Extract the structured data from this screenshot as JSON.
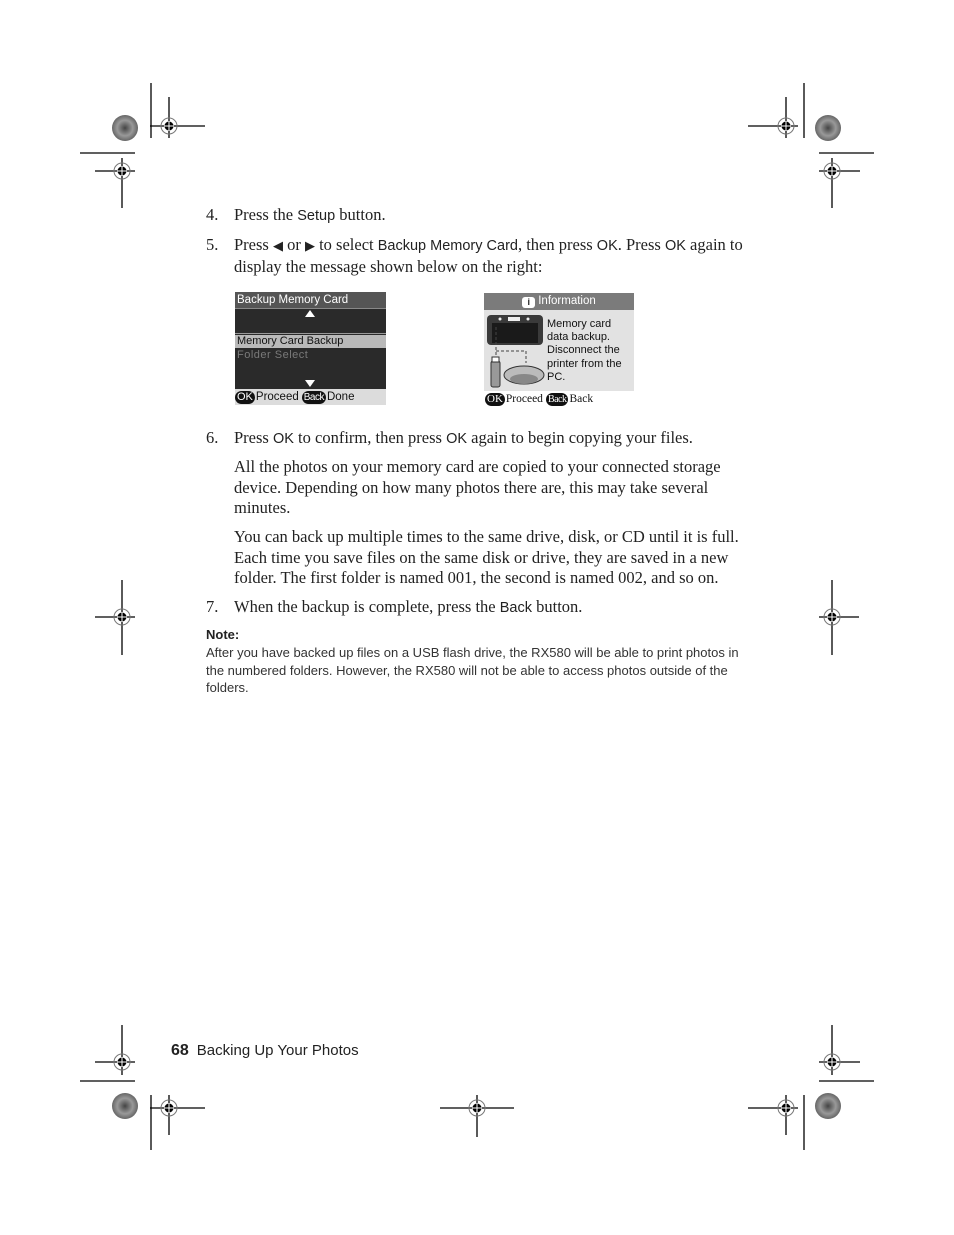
{
  "steps": [
    {
      "number": "4.",
      "parts": [
        "Press the ",
        "Setup",
        " button."
      ]
    },
    {
      "number": "5.",
      "text_a": "Press ",
      "left_arrow": "◀",
      "text_or": " or ",
      "right_arrow": "▶",
      "text_b": " to select ",
      "ui_backup": "Backup Memory Card",
      "text_c": ", then press ",
      "ui_ok1": "OK",
      "text_d": ". Press ",
      "ui_ok2": "OK",
      "text_e": " again to display the message shown below on the right:"
    },
    {
      "number": "6.",
      "text_a": "Press ",
      "ui_ok1": "OK",
      "text_b": " to confirm, then press ",
      "ui_ok2": "OK",
      "text_c": " again to begin copying your files."
    },
    {
      "number": "7.",
      "text_a": "When the backup is complete, press the ",
      "ui_back": "Back",
      "text_b": " button."
    }
  ],
  "paragraphs": [
    "All the photos on your memory card are copied to your connected storage device. Depending on how many photos there are, this may take several minutes.",
    "You can back up multiple times to the same drive, disk, or CD until it is full. Each time you save files on the same disk or drive, they are saved in a new folder. The first folder is named 001, the second is named 002, and so on."
  ],
  "screen_left": {
    "title": "Backup Memory Card",
    "items": [
      "Memory Card Backup",
      "Folder Select"
    ],
    "selected_index": 0,
    "footer": {
      "ok": "OK",
      "ok_label": "Proceed",
      "back": "Back",
      "back_label": "Done"
    }
  },
  "screen_right": {
    "title": "Information",
    "icon": "i",
    "message_lines": [
      "Memory card",
      "data backup.",
      "Disconnect the",
      "printer from the",
      "PC."
    ],
    "footer": {
      "ok": "OK",
      "ok_label": "Proceed",
      "back": "Back",
      "back_label": "Back"
    }
  },
  "note": {
    "heading": "Note:",
    "body": "After you have backed up files on a USB flash drive, the RX580 will be able to print photos in the numbered folders. However, the RX580 will not be able to access photos outside of the folders."
  },
  "footer": {
    "page_number": "68",
    "section_title": "Backing Up Your Photos"
  }
}
